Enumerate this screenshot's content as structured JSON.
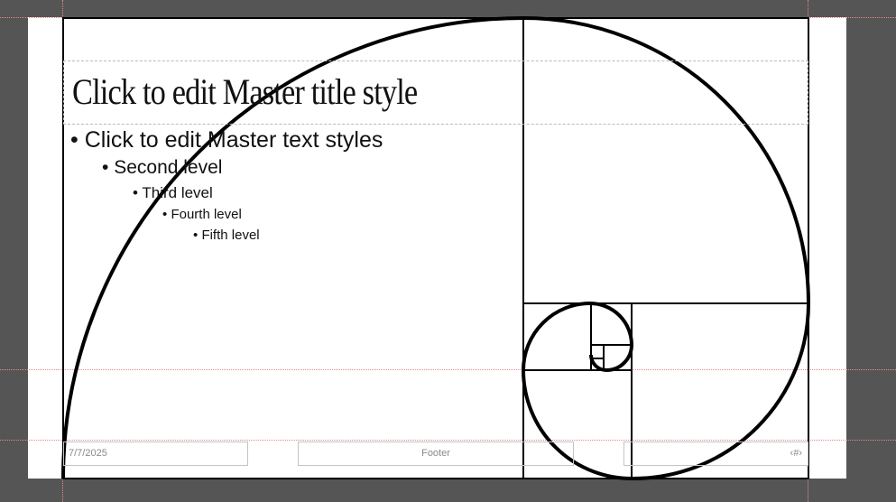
{
  "slide": {
    "title": "Click to edit Master title style",
    "body_levels": [
      "Click to edit Master text styles",
      "Second level",
      "Third level",
      "Fourth level",
      "Fifth level"
    ],
    "bullet": "•",
    "footer": {
      "date": "7/7/2025",
      "center": "Footer",
      "slide_number": "‹#›"
    }
  },
  "colors": {
    "canvas": "#555555",
    "slide": "#ffffff",
    "line": "#000000",
    "guide": "#e38a8a"
  }
}
